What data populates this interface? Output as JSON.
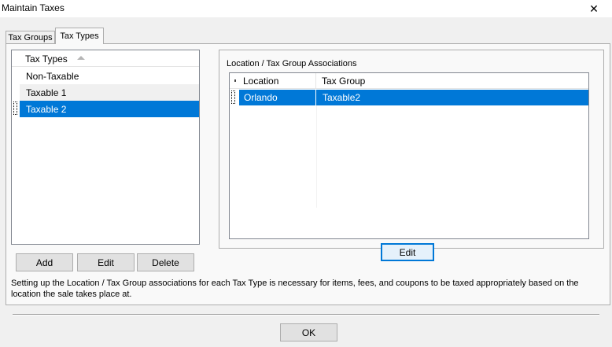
{
  "window": {
    "title": "Maintain Taxes",
    "close_glyph": "✕"
  },
  "tabs": [
    {
      "label": "Tax Groups",
      "active": false
    },
    {
      "label": "Tax Types",
      "active": true
    }
  ],
  "tax_types_list": {
    "header": "Tax Types",
    "sort_icon": "sort-ascending-icon",
    "items": [
      {
        "label": "Non-Taxable",
        "selected": false
      },
      {
        "label": "Taxable 1",
        "selected": false
      },
      {
        "label": "Taxable 2",
        "selected": true
      }
    ]
  },
  "list_buttons": {
    "add": "Add",
    "edit": "Edit",
    "delete": "Delete"
  },
  "associations": {
    "title": "Location / Tax Group Associations",
    "columns": {
      "location": "Location",
      "tax_group": "Tax Group"
    },
    "rows": [
      {
        "location": "Orlando",
        "tax_group": "Taxable2"
      }
    ],
    "edit_button": "Edit"
  },
  "info_text": "Setting up the Location / Tax Group associations for each Tax Type is necessary for items, fees, and coupons to be taxed appropriately based on the location the sale takes place at.",
  "ok_button": "OK",
  "colors": {
    "selection": "#0078d7",
    "window_bg": "#f0f0f0",
    "panel_bg": "#f9f9f9"
  }
}
